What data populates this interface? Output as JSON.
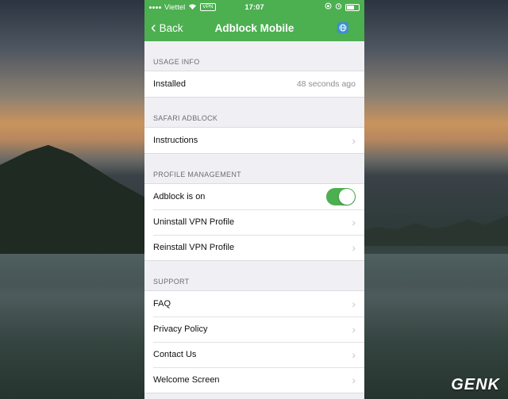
{
  "status_bar": {
    "carrier": "Viettel",
    "vpn": "VPN",
    "time": "17:07"
  },
  "nav": {
    "back_label": "Back",
    "title": "Adblock Mobile",
    "right_icon": "globe-icon"
  },
  "sections": {
    "usage": {
      "header": "USAGE INFO",
      "installed_label": "Installed",
      "installed_value": "48 seconds ago"
    },
    "safari": {
      "header": "SAFARI ADBLOCK",
      "instructions_label": "Instructions"
    },
    "profile": {
      "header": "PROFILE MANAGEMENT",
      "adblock_label": "Adblock is on",
      "adblock_on": true,
      "uninstall_label": "Uninstall VPN Profile",
      "reinstall_label": "Reinstall VPN Profile"
    },
    "support": {
      "header": "SUPPORT",
      "faq_label": "FAQ",
      "privacy_label": "Privacy Policy",
      "contact_label": "Contact Us",
      "welcome_label": "Welcome Screen"
    }
  },
  "watermark": "GENK",
  "colors": {
    "accent": "#4caf50",
    "background": "#efeff4"
  }
}
